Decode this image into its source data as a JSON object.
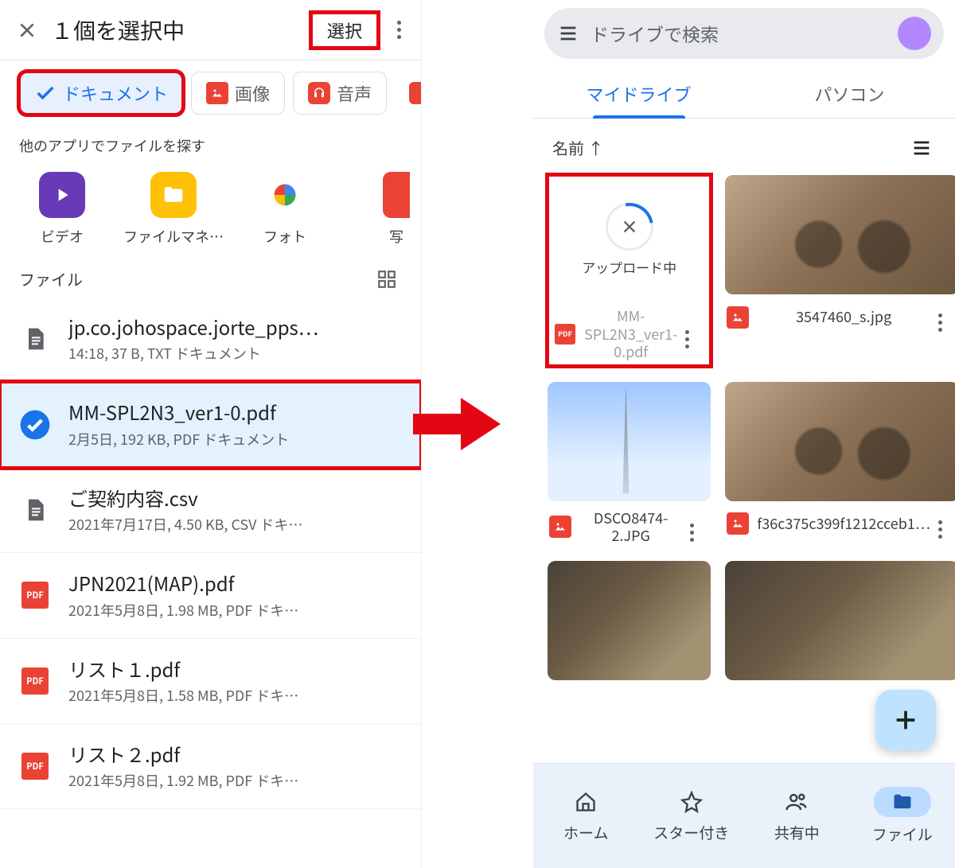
{
  "left": {
    "title": "１個を選択中",
    "select_button": "選択",
    "filters": {
      "doc": "ドキュメント",
      "image": "画像",
      "audio": "音声"
    },
    "other_apps_label": "他のアプリでファイルを探す",
    "apps": {
      "video": "ビデオ",
      "filemgr": "ファイルマネ…",
      "photos": "フォト",
      "photo2": "写"
    },
    "files_label": "ファイル",
    "files": [
      {
        "name": "jp.co.johospace.jorte_pps…",
        "meta": "14:18, 37 B, TXT ドキュメント",
        "type": "doc"
      },
      {
        "name": "MM-SPL2N3_ver1-0.pdf",
        "meta": "2月5日, 192 KB, PDF ドキュメント",
        "type": "selected"
      },
      {
        "name": "ご契約内容.csv",
        "meta": "2021年7月17日, 4.50 KB, CSV ドキ…",
        "type": "doc"
      },
      {
        "name": "JPN2021(MAP).pdf",
        "meta": "2021年5月8日, 1.98 MB, PDF ドキ…",
        "type": "pdf"
      },
      {
        "name": "リスト１.pdf",
        "meta": "2021年5月8日, 1.58 MB, PDF ドキ…",
        "type": "pdf"
      },
      {
        "name": "リスト２.pdf",
        "meta": "2021年5月8日, 1.92 MB, PDF ドキ…",
        "type": "pdf"
      }
    ]
  },
  "right": {
    "search_placeholder": "ドライブで検索",
    "tabs": {
      "mydrive": "マイドライブ",
      "computer": "パソコン"
    },
    "sort_label": "名前 ↑",
    "upload_label": "アップロード中",
    "tiles": [
      {
        "name": "MM-SPL2N3_ver1-0.pdf",
        "icon": "pdf",
        "uploading": true
      },
      {
        "name": "3547460_s.jpg",
        "icon": "img",
        "thumb": "cat"
      },
      {
        "name": "DSCO8474-2.JPG",
        "icon": "img",
        "thumb": "sky"
      },
      {
        "name": "f36c375c399f1212cceb1…",
        "icon": "img",
        "thumb": "cat"
      },
      {
        "name": "",
        "icon": "",
        "thumb": "desk"
      },
      {
        "name": "",
        "icon": "",
        "thumb": "desk"
      }
    ],
    "nav": {
      "home": "ホーム",
      "star": "スター付き",
      "shared": "共有中",
      "files": "ファイル"
    }
  }
}
